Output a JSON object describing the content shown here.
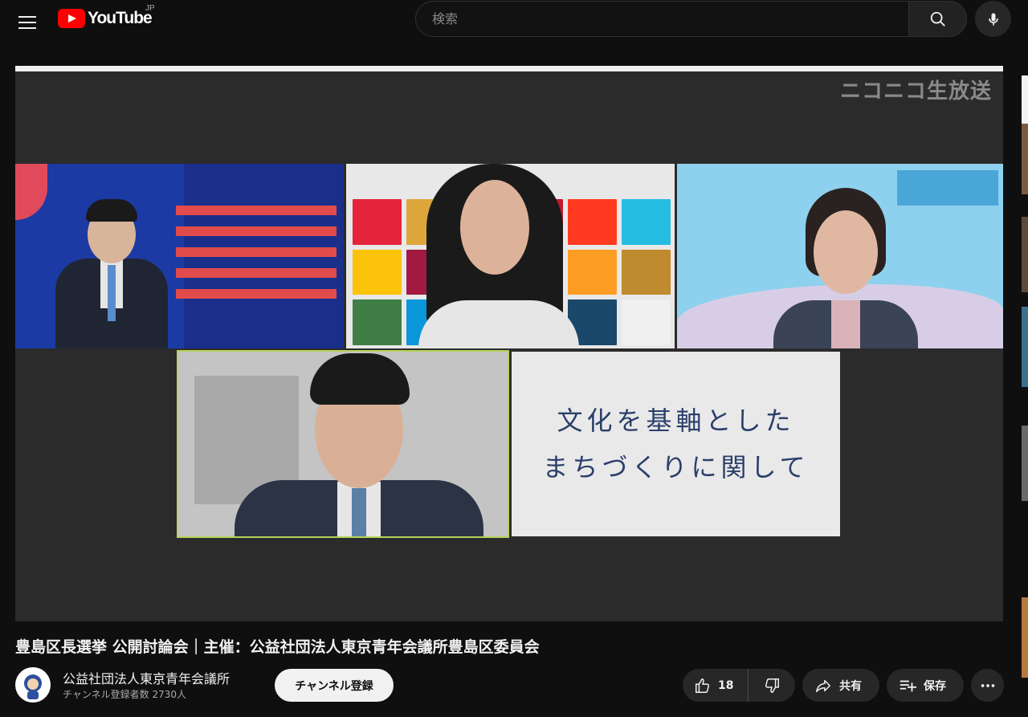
{
  "header": {
    "logo_text": "YouTube",
    "country_code": "JP",
    "search_placeholder": "検索"
  },
  "player": {
    "overlay_brand": "ニコニコ生放送",
    "slide_lines": [
      "文化を基軸とした",
      "まちづくりに関して"
    ]
  },
  "video": {
    "title": "豊島区長選挙 公開討論会｜主催：公益社団法人東京青年会議所豊島区委員会"
  },
  "channel": {
    "name": "公益社団法人東京青年会議所",
    "subscribers": "チャンネル登録者数 2730人",
    "subscribe_label": "チャンネル登録"
  },
  "actions": {
    "like_count": "18",
    "share_label": "共有",
    "save_label": "保存"
  },
  "colors": {
    "youtube_red": "#ff0000",
    "background": "#0f0f0f",
    "button_bg": "#272727"
  }
}
